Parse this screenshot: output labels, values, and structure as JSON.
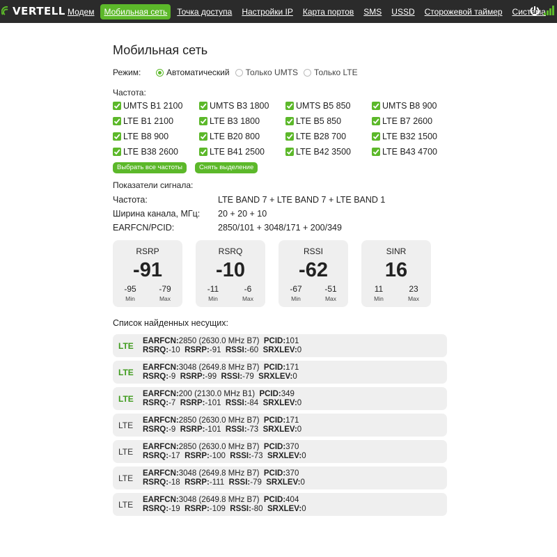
{
  "brand": {
    "name": "VERTELL"
  },
  "nav": [
    {
      "label": "Модем",
      "active": false
    },
    {
      "label": "Мобильная сеть",
      "active": true
    },
    {
      "label": "Точка доступа",
      "active": false
    },
    {
      "label": "Настройки IP",
      "active": false
    },
    {
      "label": "Карта портов",
      "active": false
    },
    {
      "label": "SMS",
      "active": false
    },
    {
      "label": "USSD",
      "active": false
    },
    {
      "label": "Сторожевой таймер",
      "active": false
    },
    {
      "label": "Система",
      "active": false
    }
  ],
  "page_title": "Мобильная сеть",
  "mode": {
    "label": "Режим:",
    "options": [
      {
        "label": "Автоматический",
        "selected": true
      },
      {
        "label": "Только UMTS",
        "selected": false
      },
      {
        "label": "Только LTE",
        "selected": false
      }
    ]
  },
  "frequency": {
    "label": "Частота:",
    "bands": [
      {
        "label": "UMTS B1 2100",
        "checked": true
      },
      {
        "label": "UMTS B3 1800",
        "checked": true
      },
      {
        "label": "UMTS B5 850",
        "checked": true
      },
      {
        "label": "UMTS B8 900",
        "checked": true
      },
      {
        "label": "LTE B1 2100",
        "checked": true
      },
      {
        "label": "LTE B3 1800",
        "checked": true
      },
      {
        "label": "LTE B5 850",
        "checked": true
      },
      {
        "label": "LTE B7 2600",
        "checked": true
      },
      {
        "label": "LTE B8 900",
        "checked": true
      },
      {
        "label": "LTE B20 800",
        "checked": true
      },
      {
        "label": "LTE B28 700",
        "checked": true
      },
      {
        "label": "LTE B32 1500",
        "checked": true
      },
      {
        "label": "LTE B38 2600",
        "checked": true
      },
      {
        "label": "LTE B41 2500",
        "checked": true
      },
      {
        "label": "LTE B42 3500",
        "checked": true
      },
      {
        "label": "LTE B43 4700",
        "checked": true
      }
    ],
    "select_all_label": "Выбрать все частоты",
    "clear_label": "Снять выделение"
  },
  "signal": {
    "label": "Показатели сигнала:",
    "rows": [
      {
        "key": "Частота:",
        "value": "LTE BAND 7 + LTE BAND 7 + LTE BAND 1"
      },
      {
        "key": "Ширина канала, МГц:",
        "value": "20 + 20 + 10"
      },
      {
        "key": "EARFCN/PCID:",
        "value": "2850/101 + 3048/171 + 200/349"
      }
    ],
    "cards": [
      {
        "title": "RSRP",
        "value": "-91",
        "min": "-95",
        "max": "-79",
        "min_label": "Min",
        "max_label": "Max"
      },
      {
        "title": "RSRQ",
        "value": "-10",
        "min": "-11",
        "max": "-6",
        "min_label": "Min",
        "max_label": "Max"
      },
      {
        "title": "RSSI",
        "value": "-62",
        "min": "-67",
        "max": "-51",
        "min_label": "Min",
        "max_label": "Max"
      },
      {
        "title": "SINR",
        "value": "16",
        "min": "11",
        "max": "23",
        "min_label": "Min",
        "max_label": "Max"
      }
    ]
  },
  "carriers": {
    "label": "Список найденных несущих:",
    "keys": {
      "earfcn": "EARFCN:",
      "pcid": "PCID:",
      "rsrq": "RSRQ:",
      "rsrp": "RSRP:",
      "rssi": "RSSI:",
      "srxlev": "SRXLEV:"
    },
    "items": [
      {
        "tech": "LTE",
        "highlight": true,
        "earfcn": "2850 (2630.0 MHz B7)",
        "pcid": "101",
        "rsrq": "-10",
        "rsrp": "-91",
        "rssi": "-60",
        "srxlev": "0"
      },
      {
        "tech": "LTE",
        "highlight": true,
        "earfcn": "3048 (2649.8 MHz B7)",
        "pcid": "171",
        "rsrq": "-9",
        "rsrp": "-99",
        "rssi": "-79",
        "srxlev": "0"
      },
      {
        "tech": "LTE",
        "highlight": true,
        "earfcn": "200 (2130.0 MHz B1)",
        "pcid": "349",
        "rsrq": "-7",
        "rsrp": "-101",
        "rssi": "-84",
        "srxlev": "0"
      },
      {
        "tech": "LTE",
        "highlight": false,
        "earfcn": "2850 (2630.0 MHz B7)",
        "pcid": "171",
        "rsrq": "-9",
        "rsrp": "-101",
        "rssi": "-73",
        "srxlev": "0"
      },
      {
        "tech": "LTE",
        "highlight": false,
        "earfcn": "2850 (2630.0 MHz B7)",
        "pcid": "370",
        "rsrq": "-17",
        "rsrp": "-100",
        "rssi": "-73",
        "srxlev": "0"
      },
      {
        "tech": "LTE",
        "highlight": false,
        "earfcn": "3048 (2649.8 MHz B7)",
        "pcid": "370",
        "rsrq": "-18",
        "rsrp": "-111",
        "rssi": "-79",
        "srxlev": "0"
      },
      {
        "tech": "LTE",
        "highlight": false,
        "earfcn": "3048 (2649.8 MHz B7)",
        "pcid": "404",
        "rsrq": "-19",
        "rsrp": "-109",
        "rssi": "-80",
        "srxlev": "0"
      }
    ]
  },
  "colors": {
    "accent": "#5cb82a",
    "topbar": "#2b2b2b",
    "card_bg": "#efefef"
  }
}
